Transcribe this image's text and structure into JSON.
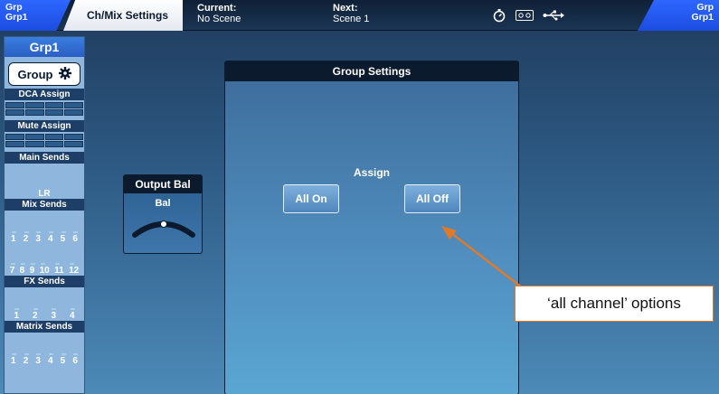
{
  "topbar": {
    "left_tab": {
      "line1": "Grp",
      "line2": "Grp1"
    },
    "chmix_tab": "Ch/Mix Settings",
    "current": {
      "label": "Current:",
      "value": "No Scene"
    },
    "next": {
      "label": "Next:",
      "value": "Scene 1"
    },
    "right_tab": {
      "line1": "Grp",
      "line2": "Grp1"
    },
    "icons": [
      "stopwatch-icon",
      "tape-icon",
      "usb-icon"
    ]
  },
  "strip": {
    "title": "Grp1",
    "group_button": "Group",
    "dca_assign": "DCA Assign",
    "mute_assign": "Mute Assign",
    "main_sends": "Main Sends",
    "lr_label": "LR",
    "mix_sends": "Mix Sends",
    "mix_row1": [
      "1",
      "2",
      "3",
      "4",
      "5",
      "6"
    ],
    "mix_row2": [
      "7",
      "8",
      "9",
      "10",
      "11",
      "12"
    ],
    "fx_sends": "FX Sends",
    "fx_row": [
      "1",
      "2",
      "3",
      "4"
    ],
    "matrix_sends": "Matrix Sends",
    "matrix_row": [
      "1",
      "2",
      "3",
      "4",
      "5",
      "6"
    ]
  },
  "output_bal": {
    "title": "Output Bal",
    "label": "Bal",
    "value": 0.5
  },
  "group_settings": {
    "title": "Group Settings",
    "assign_label": "Assign",
    "all_on": "All On",
    "all_off": "All Off"
  },
  "annotation": {
    "text": "‘all channel’ options",
    "color": "#e07a2b"
  }
}
